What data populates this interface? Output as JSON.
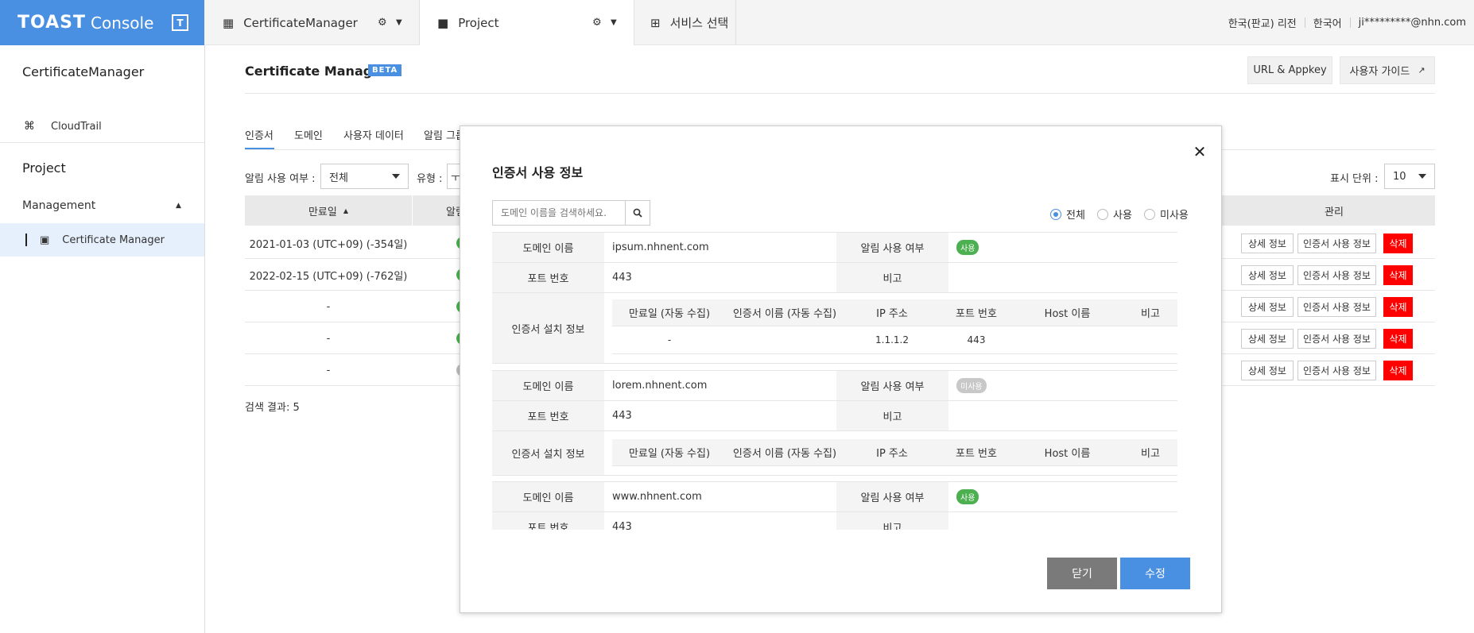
{
  "topbar": {
    "logo_toast": "TOAST",
    "logo_console": "Console",
    "logo_icon": "T",
    "tabs": [
      {
        "label": "CertificateManager"
      },
      {
        "label": "Project"
      },
      {
        "label": "서비스 선택"
      }
    ],
    "region": "한국(판교) 리전",
    "language": "한국어",
    "user": "ji*********@nhn.com"
  },
  "sidebar": {
    "service_title": "CertificateManager",
    "service_items": [
      {
        "label": "CloudTrail"
      }
    ],
    "project_title": "Project",
    "group_title": "Management",
    "group_items": [
      {
        "label": "Certificate Manager"
      }
    ]
  },
  "page": {
    "title": "Certificate Manager",
    "beta": "BETA",
    "url_appkey": "URL & Appkey",
    "user_guide": "사용자 가이드",
    "tabs": [
      "인증서",
      "도메인",
      "사용자 데이터",
      "알림 그룹"
    ],
    "filter_alarm_label": "알림 사용 여부 :",
    "filter_alarm_value": "전체",
    "filter_type_label": "유형 :",
    "filter_type_value": "ㅜ",
    "page_size_label": "표시 단위 :",
    "page_size_value": "10",
    "columns": {
      "expiry": "만료일",
      "alarm": "알림",
      "manage": "관리"
    },
    "rows": [
      {
        "expiry": "2021-01-03 (UTC+09) (-354일)",
        "alarm_on": true
      },
      {
        "expiry": "2022-02-15 (UTC+09) (-762일)",
        "alarm_on": true
      },
      {
        "expiry": "-",
        "alarm_on": true
      },
      {
        "expiry": "-",
        "alarm_on": true
      },
      {
        "expiry": "-",
        "alarm_on": false
      }
    ],
    "row_actions": {
      "detail": "상세 정보",
      "usage": "인증서 사용 정보",
      "delete": "삭제"
    },
    "result": "검색 결과: 5"
  },
  "modal": {
    "title": "인증서 사용 정보",
    "search_placeholder": "도메인 이름을 검색하세요.",
    "radio_options": [
      "전체",
      "사용",
      "미사용"
    ],
    "labels": {
      "domain": "도메인 이름",
      "alarm": "알림 사용 여부",
      "port": "포트 번호",
      "note": "비고",
      "install": "인증서 설치 정보"
    },
    "install_columns": [
      "만료일 (자동 수집)",
      "인증서 이름 (자동 수집)",
      "IP 주소",
      "포트 번호",
      "Host 이름",
      "비고"
    ],
    "entries": [
      {
        "domain": "ipsum.nhnent.com",
        "alarm": "사용",
        "alarm_on": true,
        "port": "443",
        "install_row": {
          "expiry": "-",
          "ip": "1.1.1.2",
          "port": "443"
        }
      },
      {
        "domain": "lorem.nhnent.com",
        "alarm": "미사용",
        "alarm_on": false,
        "port": "443"
      },
      {
        "domain": "www.nhnent.com",
        "alarm": "사용",
        "alarm_on": true,
        "port": "443"
      }
    ],
    "close_label": "닫기",
    "edit_label": "수정"
  },
  "colors": {
    "brand": "#4a90e2",
    "on": "#4caf50",
    "off": "#c8c8c8",
    "danger": "#ff0000",
    "close_btn": "#7a7a7a"
  }
}
